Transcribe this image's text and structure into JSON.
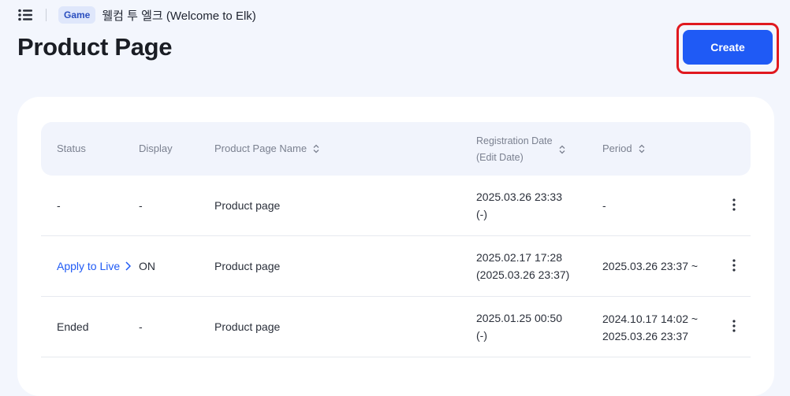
{
  "header": {
    "badge": "Game",
    "game_name": "웰컴 투 엘크 (Welcome to Elk)",
    "title": "Product Page",
    "create_label": "Create"
  },
  "table": {
    "columns": {
      "status": "Status",
      "display": "Display",
      "name": "Product Page Name",
      "reg_date": "Registration Date",
      "reg_date_sub": "(Edit Date)",
      "period": "Period"
    },
    "rows": [
      {
        "status": "-",
        "display": "-",
        "name": "Product page",
        "reg_line1": "2025.03.26 23:33",
        "reg_line2": "(-)",
        "period_line1": "-",
        "period_line2": ""
      },
      {
        "status": "Apply to Live",
        "display": "ON",
        "name": "Product page",
        "reg_line1": "2025.02.17 17:28",
        "reg_line2": "(2025.03.26 23:37)",
        "period_line1": "2025.03.26 23:37 ~",
        "period_line2": ""
      },
      {
        "status": "Ended",
        "display": "-",
        "name": "Product page",
        "reg_line1": "2025.01.25 00:50",
        "reg_line2": "(-)",
        "period_line1": "2024.10.17 14:02 ~",
        "period_line2": "2025.03.26 23:37"
      }
    ]
  },
  "colors": {
    "accent": "#1f5af5",
    "highlight": "#e0191f",
    "background": "#f3f6fd"
  },
  "icons": {
    "menu": "list-icon",
    "sort": "sort-icon",
    "more": "kebab-icon",
    "chevron": "chevron-right-icon"
  }
}
